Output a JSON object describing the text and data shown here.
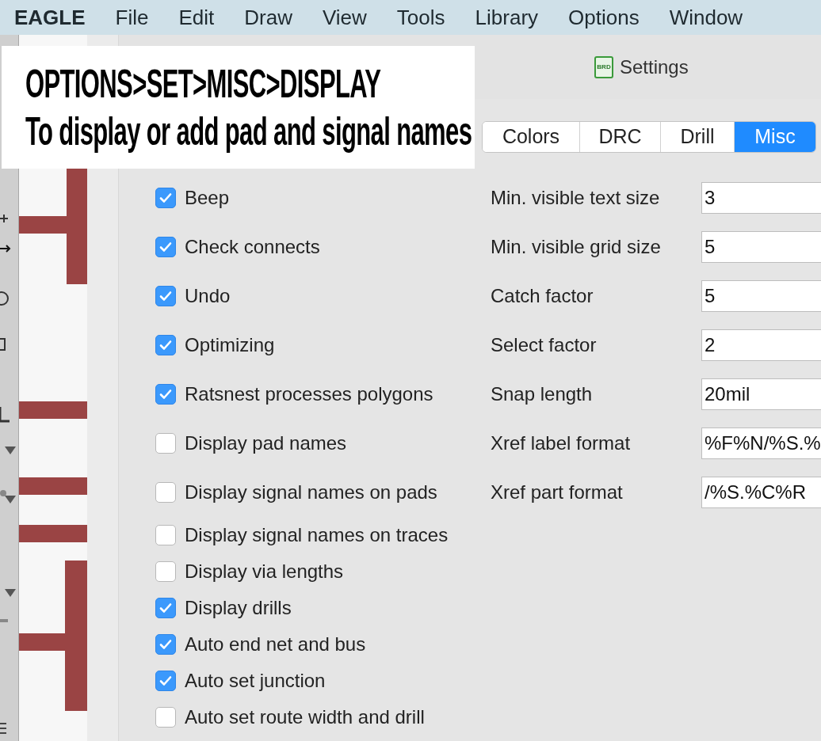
{
  "menu_bar": {
    "app": "EAGLE",
    "items": [
      "File",
      "Edit",
      "Draw",
      "View",
      "Tools",
      "Library",
      "Options",
      "Window"
    ]
  },
  "annotation": {
    "lines": [
      "OPTIONS>SET>MISC>DISPLAY",
      "To display or add pad and signal names"
    ]
  },
  "dialog": {
    "title": "Settings",
    "icon_label": "BRD",
    "tabs": [
      {
        "label": "Colors",
        "selected": false
      },
      {
        "label": "DRC",
        "selected": false
      },
      {
        "label": "Drill",
        "selected": false
      },
      {
        "label": "Misc",
        "selected": true
      }
    ],
    "options": [
      {
        "label": "Beep",
        "checked": true
      },
      {
        "label": "Check connects",
        "checked": true
      },
      {
        "label": "Undo",
        "checked": true
      },
      {
        "label": "Optimizing",
        "checked": true
      },
      {
        "label": "Ratsnest processes polygons",
        "checked": true
      },
      {
        "label": "Display pad names",
        "checked": false
      },
      {
        "label": "Display signal names on pads",
        "checked": false
      },
      {
        "label": "Display signal names on traces",
        "checked": false
      },
      {
        "label": "Display via lengths",
        "checked": false
      },
      {
        "label": "Display drills",
        "checked": true
      },
      {
        "label": "Auto end net and bus",
        "checked": true
      },
      {
        "label": "Auto set junction",
        "checked": true
      },
      {
        "label": "Auto set route width and drill",
        "checked": false
      }
    ],
    "fields": [
      {
        "label": "Min. visible text size",
        "value": "3"
      },
      {
        "label": "Min. visible grid size",
        "value": "5"
      },
      {
        "label": "Catch factor",
        "value": "5"
      },
      {
        "label": "Select factor",
        "value": "2"
      },
      {
        "label": "Snap length",
        "value": "20mil"
      },
      {
        "label": "Xref label format",
        "value": "%F%N/%S.%"
      },
      {
        "label": "Xref part format",
        "value": "/%S.%C%R"
      }
    ]
  }
}
